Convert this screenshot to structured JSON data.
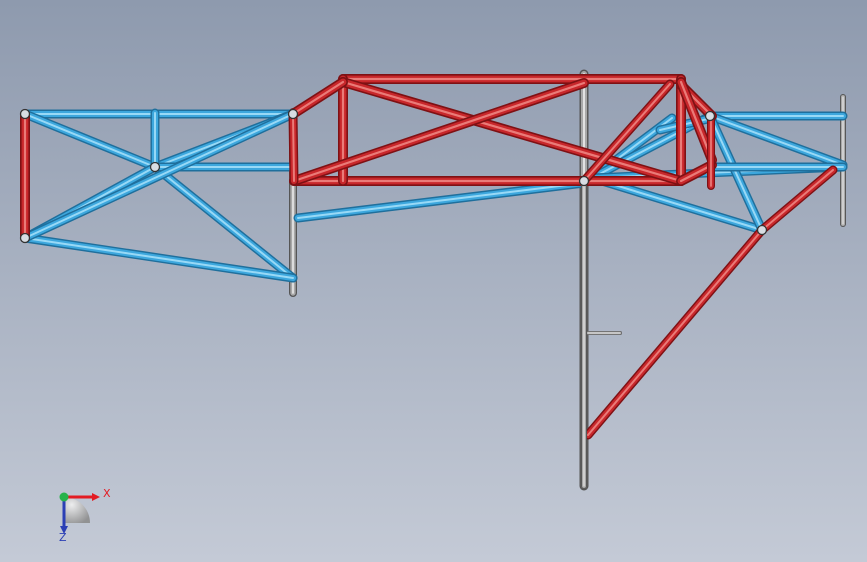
{
  "viewport": {
    "background_top": "#8e9aae",
    "background_bottom": "#c4cad6"
  },
  "colors": {
    "blue_tube": "#3da7dd",
    "blue_highlight": "#a8e2fb",
    "blue_shadow": "#1f6f9c",
    "red_tube": "#c8272b",
    "red_highlight": "#f08a86",
    "red_shadow": "#7e1114",
    "grey_tube": "#a8a8a8",
    "grey_highlight": "#eeeeee",
    "grey_shadow": "#555555"
  },
  "triad": {
    "x_label": "X",
    "z_label": "Z",
    "x_color": "#e31b23",
    "y_color": "#27b34b",
    "z_color": "#2b3fb5"
  },
  "icons": {
    "triad": "coordinate-triad-icon"
  }
}
